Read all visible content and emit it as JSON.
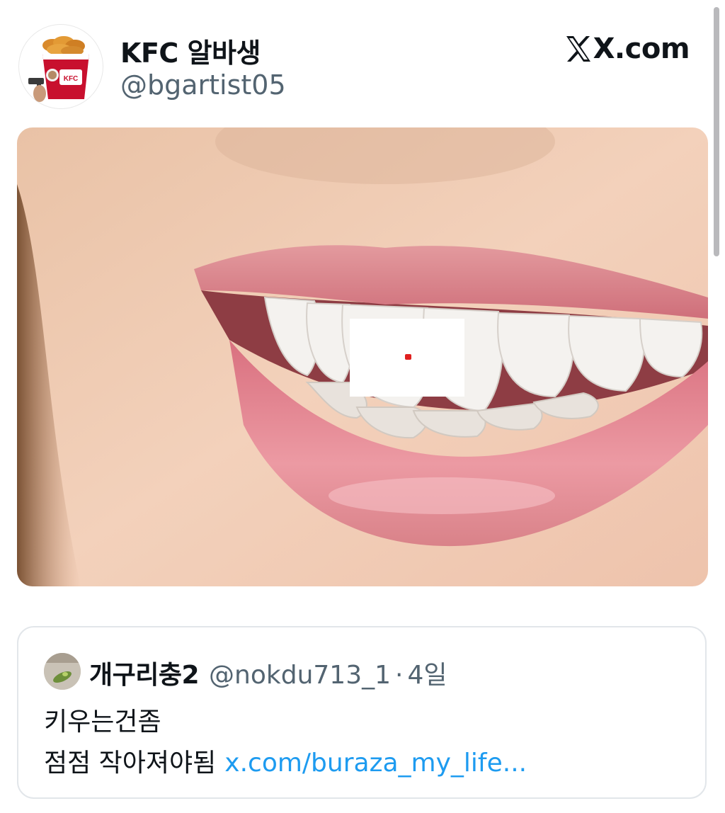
{
  "header": {
    "display_name": "KFC 알바생",
    "handle": "@bgartist05",
    "brand": "X.com",
    "avatar_icon": "kfc-bucket-avatar-icon"
  },
  "post": {
    "image": "smiling-lips-teeth-photo"
  },
  "quoted_tweet": {
    "display_name": "개구리충2",
    "handle": "@nokdu713_1",
    "separator": "·",
    "time": "4일",
    "line1": "키우는건좀",
    "line2": "점점 작아져야됨",
    "link": "x.com/buraza_my_life..."
  },
  "colors": {
    "link": "#1d9bf0",
    "secondary_text": "#536471",
    "primary_text": "#0f1419"
  }
}
